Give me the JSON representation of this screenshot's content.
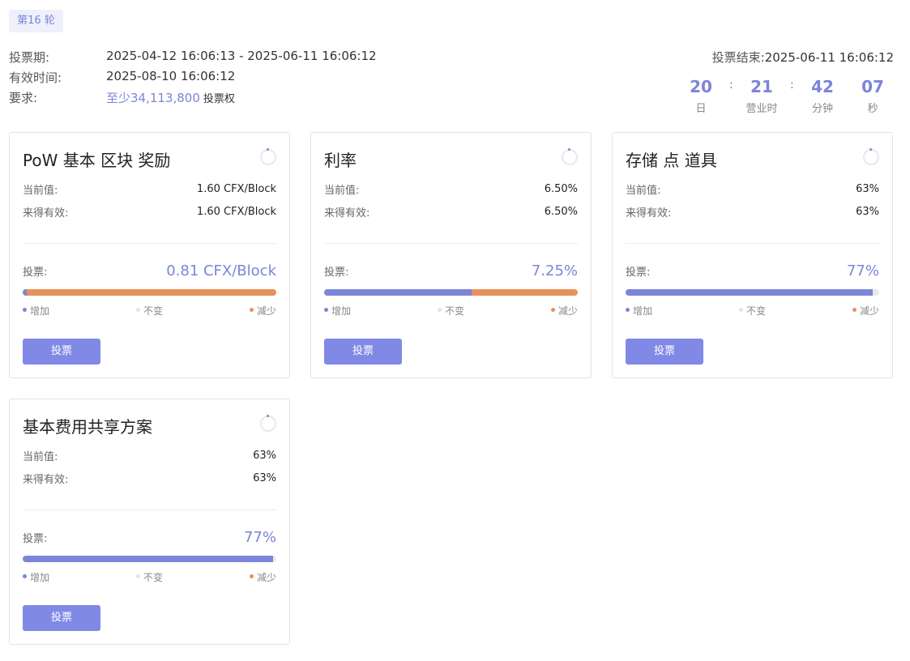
{
  "round": {
    "label": "第16 轮"
  },
  "info": {
    "period_label": "投票期:",
    "period_value": "2025-04-12 16:06:13 - 2025-06-11 16:06:12",
    "effective_label": "有效时间:",
    "effective_value": "2025-08-10 16:06:12",
    "requirement_label": "要求:",
    "requirement_amount": "至少34,113,800",
    "requirement_suffix": "投票权"
  },
  "vote_end": {
    "label": "投票结束:",
    "date": "2025-06-11 16:06:12"
  },
  "countdown": {
    "days": "20",
    "days_label": "日",
    "hours": "21",
    "hours_label": "营业时",
    "minutes": "42",
    "minutes_label": "分钟",
    "seconds": "07",
    "seconds_label": "秒",
    "separator": ":"
  },
  "legend": {
    "increase": "增加",
    "unchanged": "不变",
    "decrease": "减少"
  },
  "colors": {
    "accent": "#7b85d9",
    "decrease": "#e8915a",
    "neutral": "#eaeaea",
    "button": "#8189e6"
  },
  "cards": [
    {
      "title": "PoW 基本 区块 奖励",
      "current_label": "当前值:",
      "current_value": "1.60 CFX/Block",
      "effective_label": "来得有效:",
      "effective_value": "1.60 CFX/Block",
      "vote_label": "投票:",
      "vote_value": "0.81 CFX/Block",
      "increase_fraction": 0.015,
      "decrease_fraction": 0.985,
      "button_label": "投票"
    },
    {
      "title": "利率",
      "current_label": "当前值:",
      "current_value": "6.50%",
      "effective_label": "来得有效:",
      "effective_value": "6.50%",
      "vote_label": "投票:",
      "vote_value": "7.25%",
      "increase_fraction": 0.58,
      "decrease_fraction": 0.42,
      "button_label": "投票"
    },
    {
      "title": "存储 点 道具",
      "current_label": "当前值:",
      "current_value": "63%",
      "effective_label": "来得有效:",
      "effective_value": "63%",
      "vote_label": "投票:",
      "vote_value": "77%",
      "increase_fraction": 0.976,
      "decrease_fraction": 0,
      "button_label": "投票"
    },
    {
      "title": "基本费用共享方案",
      "current_label": "当前值:",
      "current_value": "63%",
      "effective_label": "来得有效:",
      "effective_value": "63%",
      "vote_label": "投票:",
      "vote_value": "77%",
      "increase_fraction": 0.986,
      "decrease_fraction": 0,
      "button_label": "投票"
    }
  ]
}
